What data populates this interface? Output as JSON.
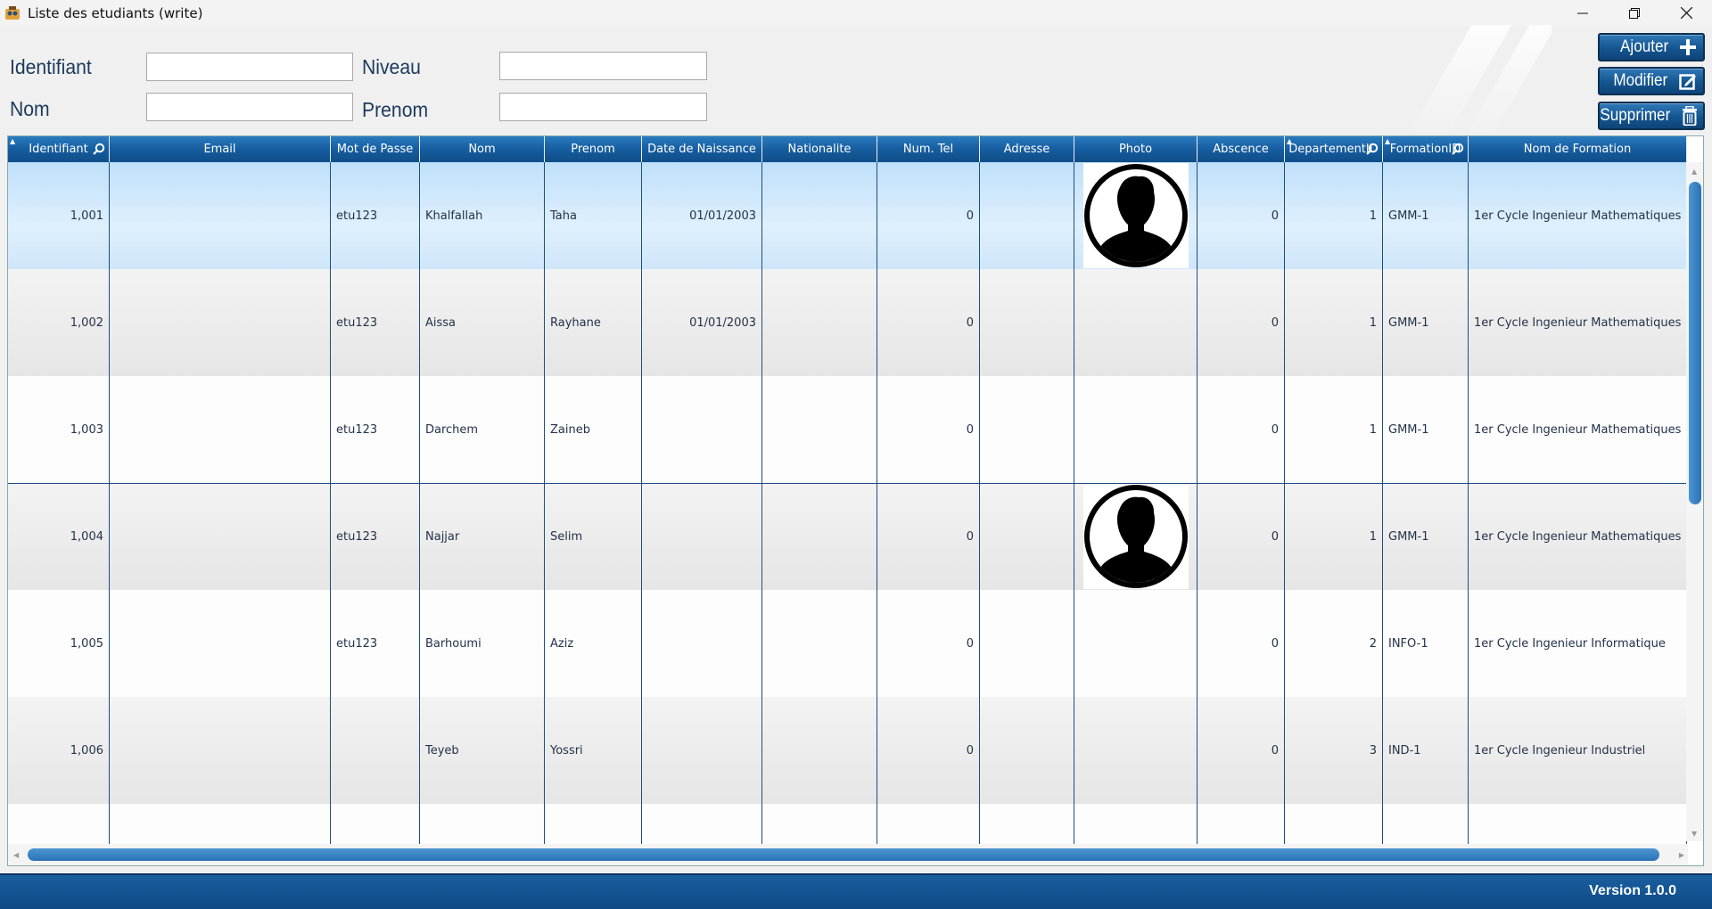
{
  "window": {
    "title": "Liste des etudiants (write)"
  },
  "form": {
    "identifiant_label": "Identifiant",
    "nom_label": "Nom",
    "niveau_label": "Niveau",
    "prenom_label": "Prenom",
    "identifiant_value": "",
    "nom_value": "",
    "niveau_value": "",
    "prenom_value": ""
  },
  "actions": {
    "ajouter": "Ajouter",
    "modifier": "Modifier",
    "supprimer": "Supprimer"
  },
  "table": {
    "columns": [
      "Identifiant",
      "Email",
      "Mot de Passe",
      "Nom",
      "Prenom",
      "Date de Naissance",
      "Nationalite",
      "Num. Tel",
      "Adresse",
      "Photo",
      "Abscence",
      "DepartementID",
      "FormationID",
      "Nom de Formation"
    ],
    "rows": [
      [
        "1,001",
        "",
        "etu123",
        "Khalfallah",
        "Taha",
        "01/01/2003",
        "",
        "0",
        "",
        "avatar",
        "0",
        "1",
        "GMM-1",
        "1er Cycle Ingenieur Mathematiques"
      ],
      [
        "1,002",
        "",
        "etu123",
        "Aissa",
        "Rayhane",
        "01/01/2003",
        "",
        "0",
        "",
        "",
        "0",
        "1",
        "GMM-1",
        "1er Cycle Ingenieur Mathematiques"
      ],
      [
        "1,003",
        "",
        "etu123",
        "Darchem",
        "Zaineb",
        "",
        "",
        "0",
        "",
        "",
        "0",
        "1",
        "GMM-1",
        "1er Cycle Ingenieur Mathematiques"
      ],
      [
        "1,004",
        "",
        "etu123",
        "Najjar",
        "Selim",
        "",
        "",
        "0",
        "",
        "avatar",
        "0",
        "1",
        "GMM-1",
        "1er Cycle Ingenieur Mathematiques"
      ],
      [
        "1,005",
        "",
        "etu123",
        "Barhoumi",
        "Aziz",
        "",
        "",
        "0",
        "",
        "",
        "0",
        "2",
        "INFO-1",
        "1er Cycle Ingenieur Informatique"
      ],
      [
        "1,006",
        "",
        "",
        "Teyeb",
        "Yossri",
        "",
        "",
        "0",
        "",
        "",
        "0",
        "3",
        "IND-1",
        "1er Cycle Ingenieur Industriel"
      ]
    ],
    "selected_row": 0
  },
  "status": {
    "version": "Version 1.0.0"
  },
  "colors": {
    "accent": "#165d9f",
    "selection": "#cfe6f9",
    "border": "#1e4e80"
  }
}
